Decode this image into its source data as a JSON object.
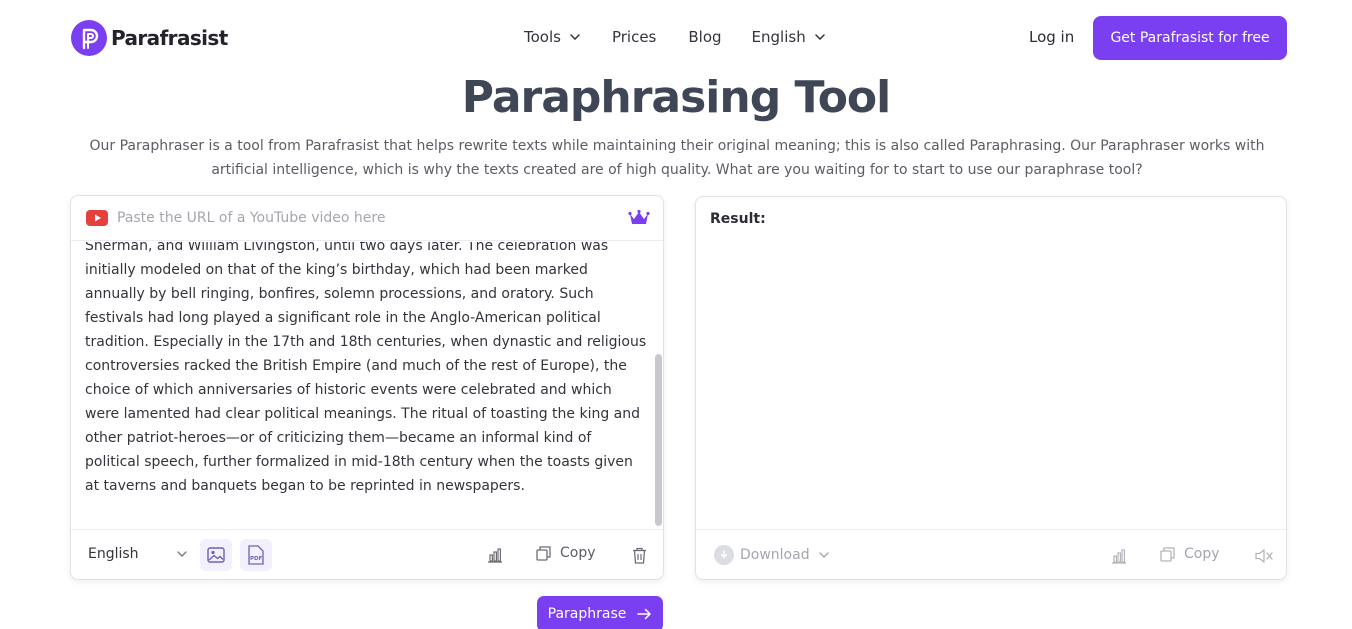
{
  "header": {
    "logo_text": "Parafrasist",
    "nav": {
      "tools": "Tools",
      "prices": "Prices",
      "blog": "Blog",
      "language": "English"
    },
    "login": "Log in",
    "cta": "Get Parafrasist for free"
  },
  "hero": {
    "title": "Paraphrasing Tool",
    "subtitle": "Our Paraphraser is a tool from Parafrasist that helps rewrite texts while maintaining their original meaning; this is also called Paraphrasing. Our Paraphraser works with artificial intelligence, which is why the texts created are of high quality. What are you waiting for to start to use our paraphrase tool?"
  },
  "input_panel": {
    "url_placeholder": "Paste the URL of a YouTube video here",
    "text": "Sherman, and William Livingston, until two days later. The celebration was initially modeled on that of the king’s birthday, which had been marked annually by bell ringing, bonfires, solemn processions, and oratory. Such festivals had long played a significant role in the Anglo-American political tradition. Especially in the 17th and 18th centuries, when dynastic and religious controversies racked the British Empire (and much of the rest of Europe), the choice of which anniversaries of historic events were celebrated and which were lamented had clear political meanings. The ritual of toasting the king and other patriot-heroes—or of criticizing them—became an informal kind of political speech, further formalized in mid-18th century when the toasts given at taverns and banquets began to be reprinted in newspapers.",
    "language": "English",
    "copy_label": "Copy",
    "pdf_label": "PDF"
  },
  "output_panel": {
    "result_label": "Result:",
    "download_label": "Download",
    "copy_label": "Copy"
  },
  "actions": {
    "paraphrase_label": "Paraphrase"
  },
  "colors": {
    "brand": "#7b3ff2",
    "title": "#3f4756",
    "youtube_red": "#e5413c"
  },
  "icons": [
    "parafrasist-logo-icon",
    "youtube-icon",
    "crown-icon",
    "image-icon",
    "pdf-icon",
    "bar-chart-icon",
    "copy-icon",
    "trash-icon",
    "download-icon",
    "mute-icon",
    "arrow-right-icon",
    "chevron-down-icon"
  ]
}
